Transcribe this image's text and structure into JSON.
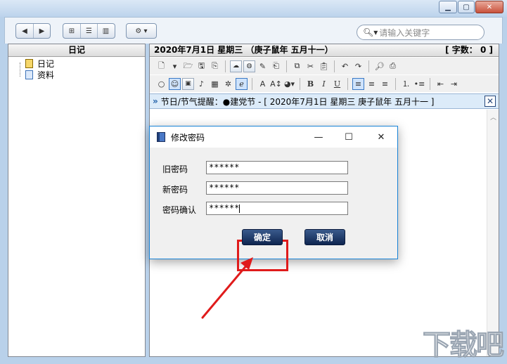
{
  "window": {
    "controls": [
      "minimize",
      "maximize",
      "close"
    ]
  },
  "toolbar": {
    "search_placeholder": "请输入关键字"
  },
  "left_pane": {
    "header": "日记",
    "tree": [
      {
        "label": "日记",
        "icon": "diary-book-icon"
      },
      {
        "label": "资料",
        "icon": "document-icon"
      }
    ]
  },
  "right_pane": {
    "date_header": "2020年7月1日  星期三 （庚子鼠年 五月十一）",
    "word_count": "[ 字数： 0 ]",
    "festival_bar": "节日/节气提醒：●建党节 - [ 2020年7月1日 星期三 庚子鼠年 五月十一 ]"
  },
  "dialog": {
    "title": "修改密码",
    "fields": [
      {
        "label": "旧密码",
        "value": "******"
      },
      {
        "label": "新密码",
        "value": "******"
      },
      {
        "label": "密码确认",
        "value": "******"
      }
    ],
    "ok_label": "确定",
    "cancel_label": "取消"
  },
  "colors": {
    "dialog_button": "#0e2550",
    "highlight": "#e01b1b",
    "festival_bg": "#dcebf9"
  },
  "watermark": "下载吧"
}
